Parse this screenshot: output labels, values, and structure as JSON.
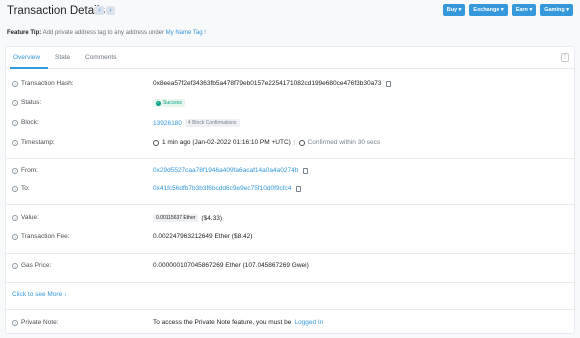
{
  "header": {
    "title": "Transaction Details",
    "prev_arrow": "‹",
    "next_arrow": "›",
    "buttons": [
      "Buy",
      "Exchange",
      "Earn",
      "Gaming"
    ]
  },
  "feature_tip": {
    "label": "Feature Tip:",
    "text": "Add private address tag to any address under",
    "link": "My Name Tag !"
  },
  "tabs": [
    "Overview",
    "State",
    "Comments"
  ],
  "overview": {
    "tx_hash_label": "Transaction Hash:",
    "tx_hash": "0x8eea57f2ef34363fb5a478f79eb0157e2254171082cd199e680ce476f3b30a73",
    "status_label": "Status:",
    "status": "Success",
    "block_label": "Block:",
    "block": "13926180",
    "confirmations": "4 Block Confirmations",
    "timestamp_label": "Timestamp:",
    "timestamp": "1 min ago (Jan-02-2022 01:16:10 PM +UTC)",
    "confirmed_within": "Confirmed within 30 secs",
    "from_label": "From:",
    "from": "0x29d5527caa78f1946a409fa6acaf14a0a4a0274b",
    "to_label": "To:",
    "to": "0x41fc56dfb7b3b3f6bcdd6c9e9ec75f10d0f9cfc4",
    "value_label": "Value:",
    "value_eth": "0.00115637 Ether",
    "value_usd": "($4.33)",
    "fee_label": "Transaction Fee:",
    "fee": "0.002247963212649 Ether ($8.42)",
    "gas_price_label": "Gas Price:",
    "gas_price": "0.000000107045867269 Ether (107.045867269 Gwei)",
    "see_more": "Click to see More",
    "private_note_label": "Private Note:",
    "private_note_text": "To access the Private Note feature, you must be",
    "private_note_link": "Logged In"
  },
  "icons": {
    "question": "?",
    "check": "✓",
    "down_arrow": "↓",
    "caret": "▾",
    "kebab": "⋮"
  },
  "colors": {
    "accent": "#3498db",
    "success": "#00a186"
  }
}
